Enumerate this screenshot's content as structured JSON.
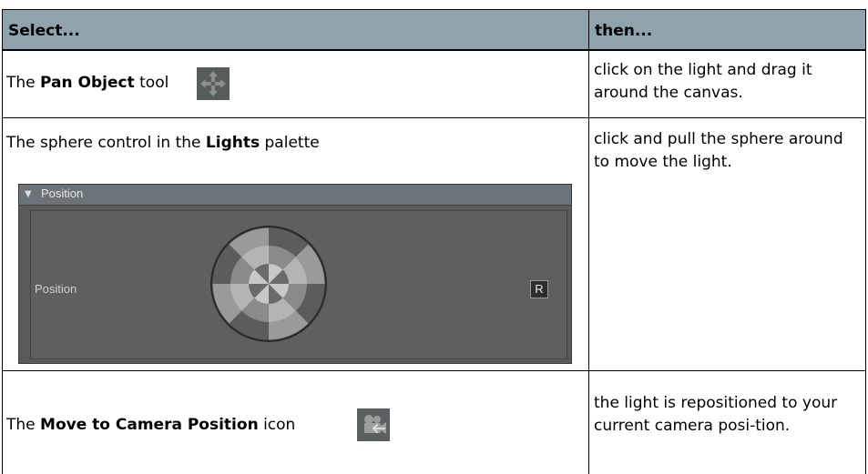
{
  "header": {
    "col1": "Select...",
    "col2": "then..."
  },
  "rows": [
    {
      "pre": "The ",
      "bold": "Pan Object",
      "post": " tool",
      "icon": "pan-move-icon",
      "then": "click on the light and drag it around the canvas."
    },
    {
      "pre": "The sphere control in the ",
      "bold": "Lights",
      "post": " palette",
      "then": "click and pull the sphere around to move the light.",
      "palette": {
        "section_title": "Position",
        "label": "Position",
        "reset_label": "R"
      }
    },
    {
      "pre": "The ",
      "bold": "Move to Camera Position",
      "post": " icon",
      "icon": "move-to-camera-icon",
      "then": "the light is repositioned to your current camera posi-tion."
    }
  ],
  "colors": {
    "header_bg": "#8fa3ad",
    "palette_bg": "#5a5a5a"
  }
}
